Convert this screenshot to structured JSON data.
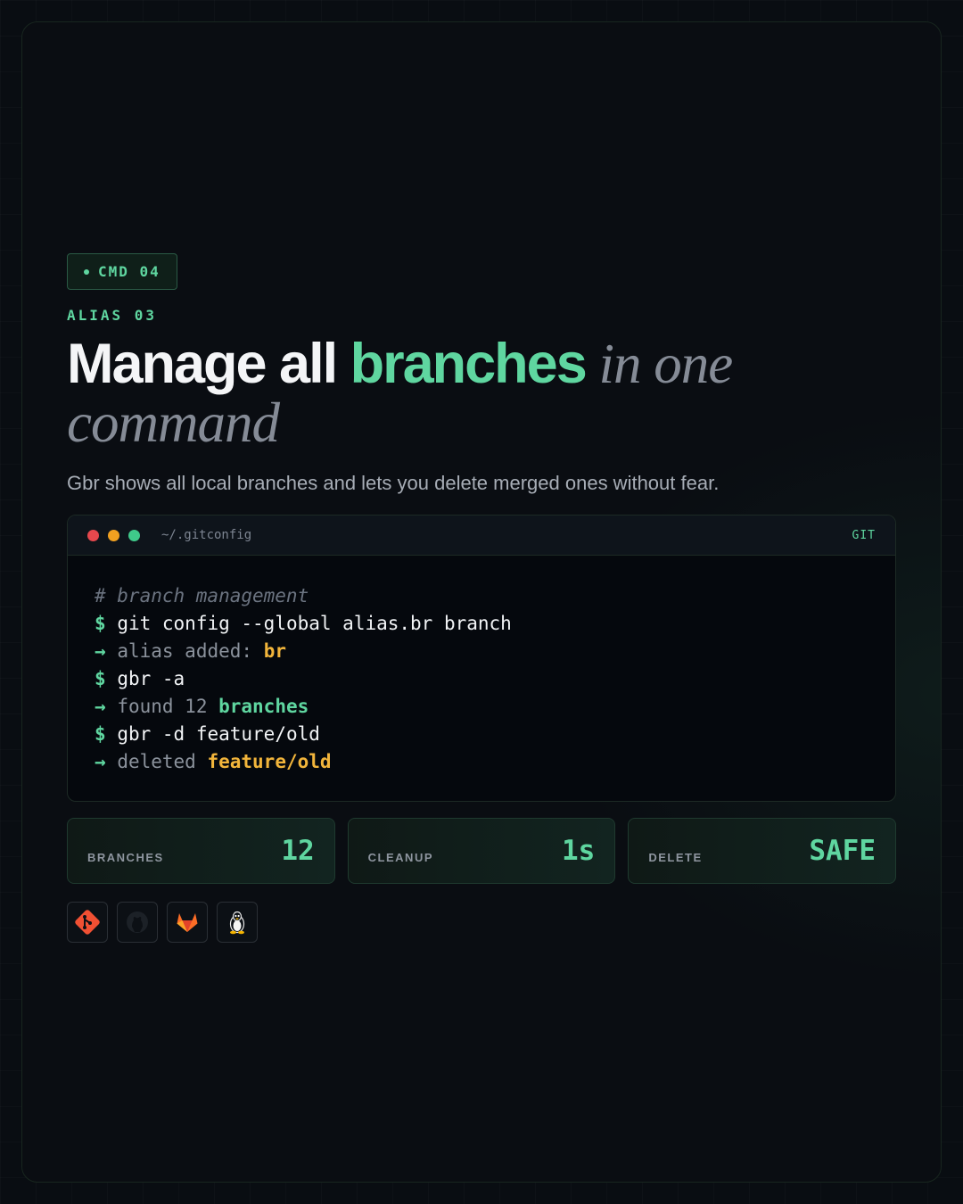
{
  "tag": {
    "label": "CMD 04"
  },
  "kicker": "ALIAS 03",
  "headline": {
    "part1": "Manage all ",
    "accent": "branches",
    "soft": " in one command"
  },
  "subtitle": "Gbr shows all local branches and lets you delete merged ones without fear.",
  "terminal": {
    "path": "~/.gitconfig",
    "lang": "GIT",
    "colors": {
      "red": "#e5484d",
      "yellow": "#f0a020",
      "green": "#3fc98a"
    },
    "lines": {
      "comment": "# branch management",
      "cmd1": "git config --global alias.br branch",
      "out1_text": "alias added: ",
      "out1_hl": "br",
      "cmd2": "gbr -a",
      "out2_text": "found 12 ",
      "out2_hl": "branches",
      "cmd3": "gbr -d feature/old",
      "out3_text": "deleted ",
      "out3_hl": "feature/old"
    },
    "prompt_symbol": "$",
    "arrow_symbol": "→"
  },
  "stats": [
    {
      "label": "BRANCHES",
      "value": "12"
    },
    {
      "label": "CLEANUP",
      "value": "1s"
    },
    {
      "label": "DELETE",
      "value": "SAFE"
    }
  ],
  "icons": [
    "git-icon",
    "github-icon",
    "gitlab-icon",
    "linux-icon"
  ],
  "accent_color": "#5fd6a0"
}
